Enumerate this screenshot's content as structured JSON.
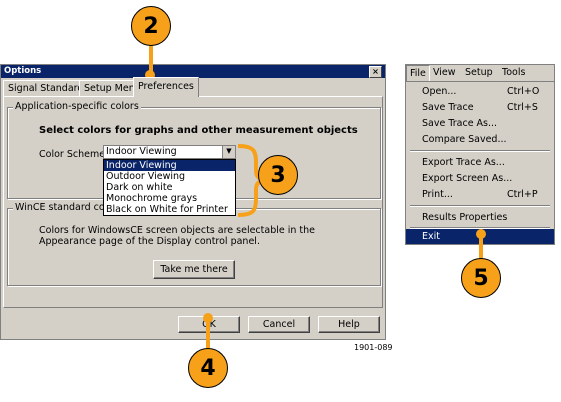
{
  "window": {
    "title": "Options",
    "close": "×"
  },
  "tabs": [
    "Signal Standards",
    "Setup Menu",
    "Preferences"
  ],
  "app_colors": {
    "group_label": "Application-specific colors",
    "heading": "Select colors for graphs and other measurement objects",
    "scheme_label": "Color Scheme:",
    "scheme_value": "Indoor Viewing",
    "options": [
      "Indoor Viewing",
      "Outdoor Viewing",
      "Dark on white",
      "Monochrome grays",
      "Black on White for Printer"
    ]
  },
  "wince": {
    "group_label": "WinCE standard colors",
    "description": "Colors for WindowsCE screen objects are selectable in the Appearance page of the Display control panel.",
    "button": "Take me there"
  },
  "footer": {
    "ok": "OK",
    "cancel": "Cancel",
    "help": "Help"
  },
  "figure_number": "1901-089",
  "menu": {
    "bar": [
      "File",
      "View",
      "Setup",
      "Tools"
    ],
    "items": [
      {
        "label": "Open...",
        "shortcut": "Ctrl+O"
      },
      {
        "label": "Save Trace",
        "shortcut": "Ctrl+S"
      },
      {
        "label": "Save Trace As...",
        "shortcut": ""
      },
      {
        "label": "Compare Saved...",
        "shortcut": ""
      },
      {
        "label": "Export Trace As...",
        "shortcut": ""
      },
      {
        "label": "Export Screen As...",
        "shortcut": ""
      },
      {
        "label": "Print...",
        "shortcut": "Ctrl+P"
      },
      {
        "label": "Results Properties",
        "shortcut": ""
      },
      {
        "label": "Exit",
        "shortcut": ""
      }
    ]
  },
  "callouts": [
    "2",
    "3",
    "4",
    "5"
  ],
  "colors": {
    "callout": "#f7a11a",
    "selection": "#0a246a",
    "face": "#d4d0c8"
  }
}
